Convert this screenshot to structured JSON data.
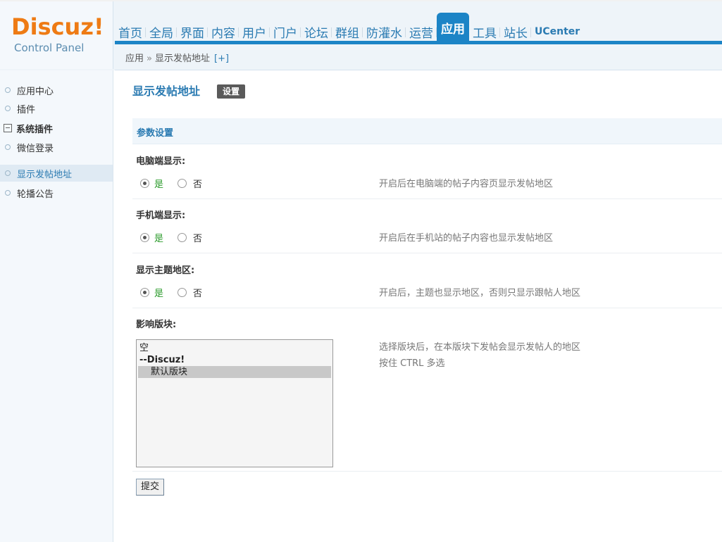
{
  "header": {
    "logo": "Discuz",
    "logo_bang": "!",
    "subtitle": "Control Panel",
    "nav": [
      "首页",
      "全局",
      "界面",
      "内容",
      "用户",
      "门户",
      "论坛",
      "群组",
      "防灌水",
      "运营",
      "应用",
      "工具",
      "站长",
      "UCenter"
    ],
    "active_nav": "应用",
    "breadcrumb": {
      "root": "应用",
      "sep": "»",
      "current": "显示发帖地址",
      "plus": "[+]"
    }
  },
  "sidebar": {
    "items": [
      {
        "label": "应用中心"
      },
      {
        "label": "插件"
      },
      {
        "label": "系统插件",
        "group": true
      },
      {
        "label": "微信登录"
      },
      {
        "label": "显示发帖地址",
        "active": true
      },
      {
        "label": "轮播公告"
      }
    ]
  },
  "main": {
    "title": "显示发帖地址",
    "title_button": "设置",
    "section": "参数设置",
    "fields": [
      {
        "label": "电脑端显示:",
        "yes": "是",
        "no": "否",
        "value": "yes",
        "hint": "开启后在电脑端的帖子内容页显示发帖地区"
      },
      {
        "label": "手机端显示:",
        "yes": "是",
        "no": "否",
        "value": "yes",
        "hint": "开启后在手机站的帖子内容也显示发帖地区"
      },
      {
        "label": "显示主题地区:",
        "yes": "是",
        "no": "否",
        "value": "yes",
        "hint": "开启后，主题也显示地区，否则只显示跟帖人地区"
      }
    ],
    "forums": {
      "label": "影响版块:",
      "options": [
        {
          "text": "空"
        },
        {
          "text": "--Discuz!",
          "group": true
        },
        {
          "text": "默认版块",
          "selected": true
        }
      ],
      "hint1": "选择版块后，在本版块下发帖会显示发帖人的地区",
      "hint2": "按住 CTRL 多选"
    },
    "submit": "提交"
  }
}
